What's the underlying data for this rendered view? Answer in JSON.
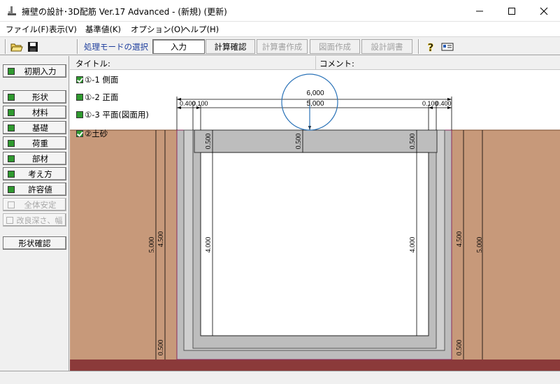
{
  "window": {
    "title": "擁壁の設計･3D配筋 Ver.17 Advanced  -  (新規)  (更新)"
  },
  "menu": [
    {
      "label": "ファイル(F)"
    },
    {
      "label": "表示(V)"
    },
    {
      "label": "基準値(K)"
    },
    {
      "label": "オプション(O)"
    },
    {
      "label": "ヘルプ(H)"
    }
  ],
  "toolbar": {
    "mode_label": "処理モードの選択",
    "buttons": {
      "input": "入力",
      "calc_confirm": "計算確認",
      "calc_report": "計算書作成",
      "drawing": "図面作成",
      "design_survey": "設計調書"
    }
  },
  "sidebar": {
    "initial_input": "初期入力",
    "items": [
      {
        "label": "形状"
      },
      {
        "label": "材料"
      },
      {
        "label": "基礎"
      },
      {
        "label": "荷重"
      },
      {
        "label": "部材"
      },
      {
        "label": "考え方"
      },
      {
        "label": "許容値"
      },
      {
        "label": "全体安定"
      },
      {
        "label": "改良深さ、幅"
      }
    ],
    "shape_check": "形状確認"
  },
  "header": {
    "title_label": "タイトル:",
    "comment_label": "コメント:"
  },
  "layers": [
    {
      "label": "①-1 側面",
      "checked": true
    },
    {
      "label": "①-2 正面",
      "checked": false
    },
    {
      "label": "①-3 平面(図面用)",
      "checked": false
    },
    {
      "label": "②土砂",
      "checked": true
    }
  ],
  "drawing": {
    "dims_top": {
      "overall": "6,000",
      "inner": "5,000",
      "left_a": "0.400",
      "left_b": "0.100",
      "right_a": "0.100",
      "right_b": "0.400"
    },
    "dims_vertical": {
      "outer_left": "5.000",
      "outer_left_inner": "4.500",
      "outer_right": "5.000",
      "outer_right_inner": "4.500",
      "inner_left": "4.000",
      "inner_right": "4.000",
      "top_slab_left": "0.500",
      "top_slab_center": "0.500",
      "top_slab_right": "0.500",
      "bottom_left": "0.500",
      "bottom_right": "0.500"
    },
    "colors": {
      "soil": "#c7997a",
      "concrete_outer": "#bdbdbd",
      "concrete_inner": "#cfcfcf",
      "base": "#8b3a3a",
      "highlight_circle": "#2b73b8"
    }
  }
}
